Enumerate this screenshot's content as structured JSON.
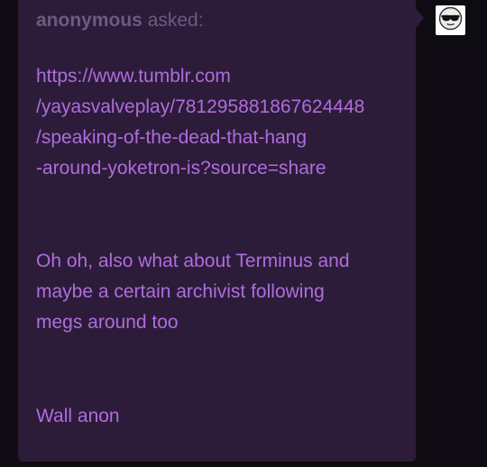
{
  "ask": {
    "asker_name": "anonymous",
    "asked_label": "asked:",
    "link_lines": [
      "https://www.tumblr.com",
      "/yayasvalveplay/781295881867624448",
      "/speaking-of-the-dead-that-hang",
      "-around-yoketron-is?source=share"
    ],
    "message_lines": [
      "Oh oh, also what about Terminus and",
      "maybe a certain archivist following",
      "megs around too"
    ],
    "signoff": "Wall anon"
  },
  "avatar": {
    "icon": "sunglasses-face-icon"
  },
  "colors": {
    "page_background": "#0f0b12",
    "bubble_background": "#2c1c3a",
    "text_purple": "#b06cdc",
    "asker_text": "#6e5a80"
  }
}
